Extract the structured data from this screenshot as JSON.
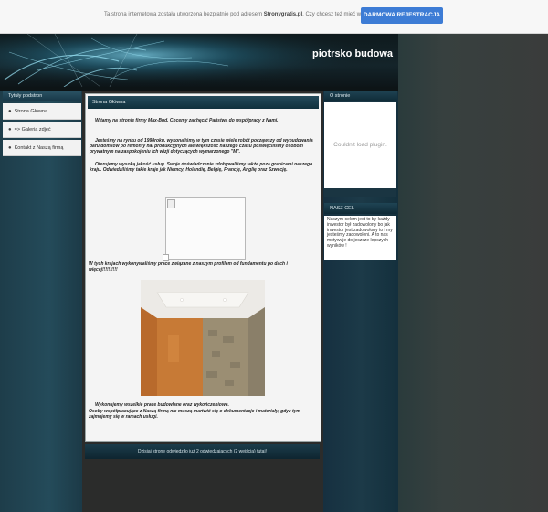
{
  "notice": {
    "text_before": "Ta strona internetowa została utworzona bezpłatnie pod adresem ",
    "domain": "Stronygratis.pl",
    "text_after": ". Czy chcesz też mieć własną stronę?",
    "button_label": "DARMOWA REJESTRACJA"
  },
  "site": {
    "title": "piotrsko budowa"
  },
  "sidebar": {
    "heading": "Tytuły podstron",
    "items": [
      {
        "label": "Strona Główna"
      },
      {
        "label": "=> Galeria zdjęć"
      },
      {
        "label": "Kontakt z Naszą firmą"
      }
    ]
  },
  "main": {
    "card_title": "Strona Główna",
    "p1": "Witamy na stronie firmy Max-Bud. Chcemy zachęcić Państwa do współpracy z Nami.",
    "p2": "Jesteśmy na rynku od 1998roku. wykonaliśmy w tym czasie wiele robót począwszy od wybudowania paru domków po remonty hal produkcyjnych ale większość naszego czasu poświęciliśmy osobom prywatnym na zaspokojeniu ich wizji dotyczących wymarzonego \"M\".",
    "p3": "Oferujemy wysoką jakość usług. Swoje doświadczenie zdobywaliśmy także poza granicami naszego kraju. Odwiedziliśmy takie kraje jak Niemcy, Holandię, Belgię, Francję, Anglię oraz Szwecję.",
    "p4": "W tych krajach wykonywaliśmy prace związane z naszym profilem od fundamentu po dach i więcej!!!!!!!!!!",
    "p5": "Wykonujemy wszelkie prace budowlane oraz wykończeniowe.",
    "p6": "Osoby współpracujące z Naszą firmą nie muszą martwić się o dokumentacje i materiały, gdyż tym zajmujemy się w ramach usługi.",
    "visit_counter": "Dzisiaj stronę odwiedziło już 2 odwiedzających (2 wejścia) tutaj!"
  },
  "right": {
    "about_heading": "O stronie",
    "plugin_message": "Couldn't load plugin.",
    "goal_heading": "NASZ CEL",
    "goal_text": "Naszym celem jest to by każdy inwestor był zadowolony bo jak inwestor jest zadowolony to i my jesteśmy zadowoleni. A to nas motywuje do jeszcze lepszych wyników !"
  },
  "colors": {
    "button_blue": "#3d7cd5",
    "panel_teal": "#1f4454"
  }
}
